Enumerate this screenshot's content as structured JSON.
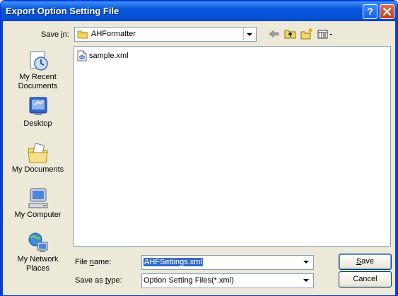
{
  "window": {
    "title": "Export Option Setting File"
  },
  "toolbar": {
    "save_in_label": "Save in:",
    "save_in_label_prefix": "Save ",
    "save_in_label_access": "i",
    "save_in_label_suffix": "n:",
    "current_folder": "AHFormatter"
  },
  "places": [
    {
      "label_line1": "My Recent",
      "label_line2": "Documents",
      "icon": "recent-documents-icon"
    },
    {
      "label_line1": "Desktop",
      "label_line2": "",
      "icon": "desktop-icon"
    },
    {
      "label_line1": "My Documents",
      "label_line2": "",
      "icon": "my-documents-icon"
    },
    {
      "label_line1": "My Computer",
      "label_line2": "",
      "icon": "my-computer-icon"
    },
    {
      "label_line1": "My Network",
      "label_line2": "Places",
      "icon": "network-places-icon"
    }
  ],
  "files": [
    {
      "name": "sample.xml",
      "icon": "xml-file-icon"
    }
  ],
  "form": {
    "file_name_label_prefix": "File ",
    "file_name_label_access": "n",
    "file_name_label_suffix": "ame:",
    "file_name_value": "AHFSettings.xml",
    "save_type_label_prefix": "Save as ",
    "save_type_label_access": "t",
    "save_type_label_suffix": "ype:",
    "save_type_value": "Option Setting Files(*.xml)"
  },
  "buttons": {
    "save_access": "S",
    "save_rest": "ave",
    "cancel": "Cancel"
  },
  "colors": {
    "titlebar": "#0854dc",
    "selection": "#316ac5",
    "dialog_bg": "#ece9d8"
  }
}
